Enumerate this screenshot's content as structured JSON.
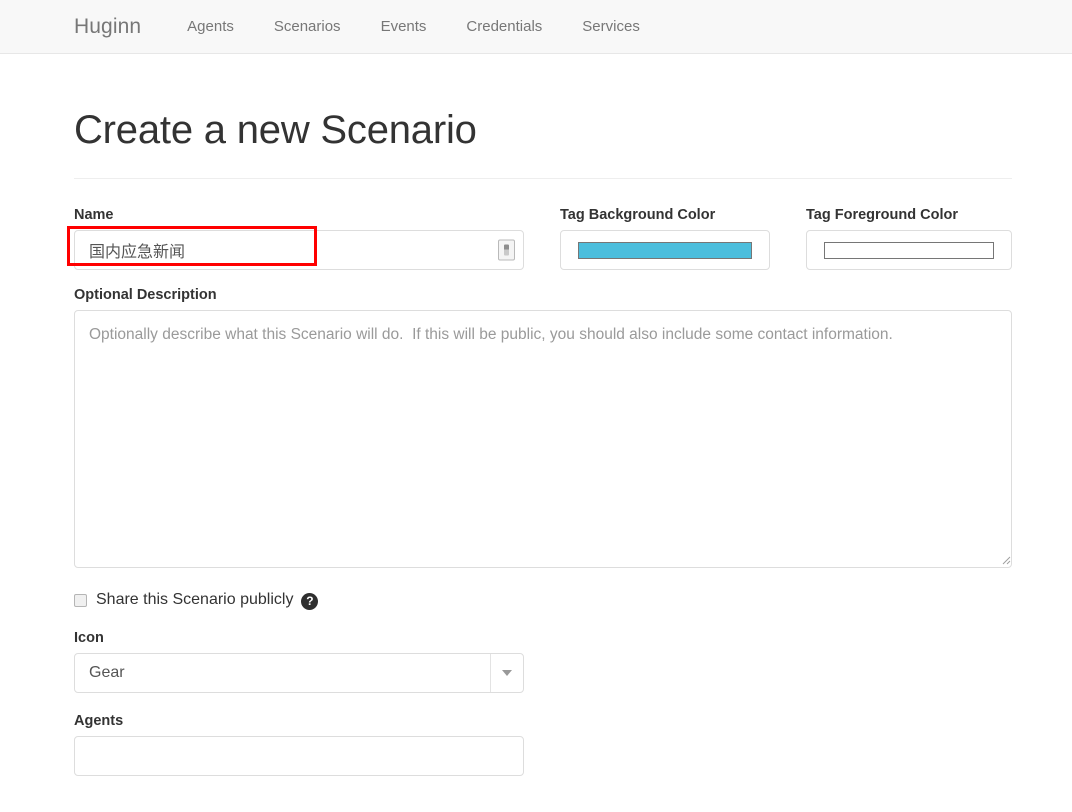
{
  "navbar": {
    "brand": "Huginn",
    "links": [
      {
        "label": "Agents"
      },
      {
        "label": "Scenarios"
      },
      {
        "label": "Events"
      },
      {
        "label": "Credentials"
      },
      {
        "label": "Services"
      }
    ]
  },
  "page": {
    "title": "Create a new Scenario"
  },
  "form": {
    "name": {
      "label": "Name",
      "value": "国内应急新闻",
      "placeholder": "",
      "autofill_icon": "autofill-icon"
    },
    "tag_background": {
      "label": "Tag Background Color",
      "color": "#4BBEDD"
    },
    "tag_foreground": {
      "label": "Tag Foreground Color",
      "color": "#FFFFFF"
    },
    "description": {
      "label": "Optional Description",
      "value": "",
      "placeholder": "Optionally describe what this Scenario will do.  If this will be public, you should also include some contact information."
    },
    "share": {
      "label": "Share this Scenario publicly",
      "checked": false,
      "help_icon": "question-mark-icon"
    },
    "icon": {
      "label": "Icon",
      "selected": "Gear",
      "caret_icon": "chevron-down-icon"
    },
    "agents": {
      "label": "Agents",
      "value": ""
    }
  },
  "annotation": {
    "highlight_color": "#FF0000",
    "target": "name-input"
  }
}
